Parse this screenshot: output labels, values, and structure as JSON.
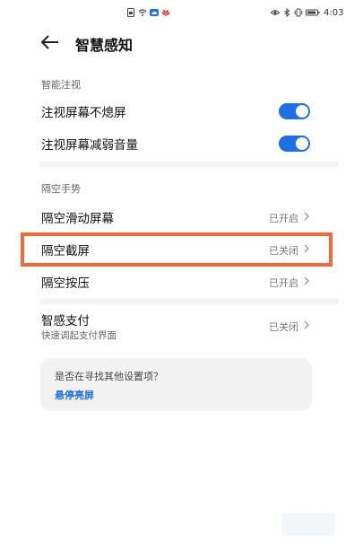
{
  "status_bar": {
    "time": "4:03",
    "left_icons": [
      "sim-icon",
      "wifi-icon",
      "cloud-icon",
      "huawei-icon"
    ],
    "right_icons": [
      "eye-icon",
      "bluetooth-icon",
      "vibrate-icon",
      "battery-icon"
    ]
  },
  "header": {
    "title": "智慧感知",
    "back_icon": "back-arrow-icon"
  },
  "sections": {
    "gaze": {
      "label": "智能注视",
      "items": [
        {
          "label": "注视屏幕不熄屏",
          "toggle": true
        },
        {
          "label": "注视屏幕减弱音量",
          "toggle": true
        }
      ]
    },
    "air_gesture": {
      "label": "隔空手势",
      "items": [
        {
          "label": "隔空滑动屏幕",
          "value": "已开启"
        },
        {
          "label": "隔空截屏",
          "value": "已关闭"
        },
        {
          "label": "隔空按压",
          "value": "已开启"
        }
      ]
    },
    "smart_pay": {
      "label": "智感支付",
      "subtitle": "快速调起支付界面",
      "value": "已关闭"
    }
  },
  "suggestion_card": {
    "question": "是否在寻找其他设置项？",
    "link": "悬停亮屏"
  },
  "colors": {
    "accent": "#1f6fe5",
    "highlight": "#f06a3a"
  }
}
